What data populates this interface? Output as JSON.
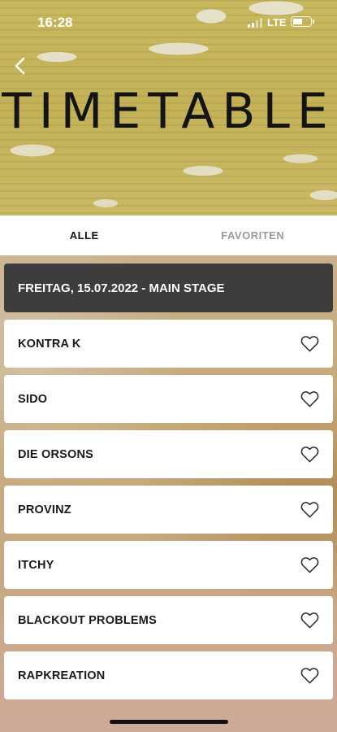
{
  "status_bar": {
    "time": "16:28",
    "network": "LTE",
    "battery_level": 0.55
  },
  "header": {
    "title": "TIMETABLE",
    "back_icon": "chevron-left-icon"
  },
  "tabs": [
    {
      "label": "ALLE",
      "active": true
    },
    {
      "label": "FAVORITEN",
      "active": false
    }
  ],
  "day_header": "FREITAG, 15.07.2022 - MAIN STAGE",
  "acts": [
    {
      "name": "KONTRA K",
      "favorite": false
    },
    {
      "name": "SIDO",
      "favorite": false
    },
    {
      "name": "DIE ORSONS",
      "favorite": false
    },
    {
      "name": "PROVINZ",
      "favorite": false
    },
    {
      "name": "ITCHY",
      "favorite": false
    },
    {
      "name": "BLACKOUT PROBLEMS",
      "favorite": false
    },
    {
      "name": "RAPKREATION",
      "favorite": false
    }
  ],
  "icons": {
    "favorite": "heart-outline-icon"
  },
  "colors": {
    "day_header_bg": "#3d3d3d",
    "title_color": "#141414",
    "inactive_tab": "#9a9a9a"
  }
}
